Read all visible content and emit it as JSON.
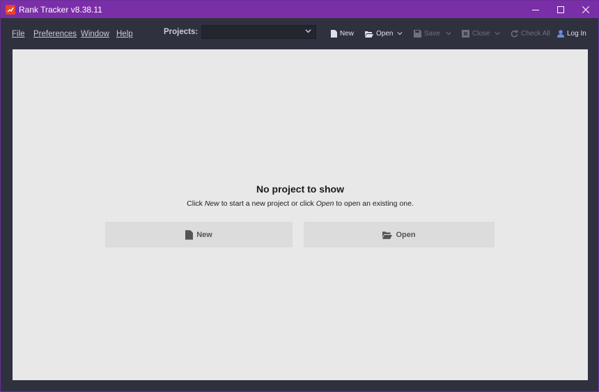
{
  "window": {
    "title": "Rank Tracker v8.38.11",
    "controls": [
      "minimize",
      "maximize",
      "close"
    ]
  },
  "menu": {
    "items": [
      {
        "label": "File"
      },
      {
        "label": "Preferences"
      },
      {
        "label": "Window"
      },
      {
        "label": "Help"
      }
    ]
  },
  "projects": {
    "label": "Projects:",
    "selected": ""
  },
  "toolbar": {
    "new_label": "New",
    "open_label": "Open",
    "save_label": "Save",
    "close_label": "Close",
    "check_all_label": "Check All",
    "login_label": "Log In"
  },
  "empty_state": {
    "title": "No project to show",
    "subtitle_1": "Click ",
    "subtitle_new": "New",
    "subtitle_2": " to start a new project or click ",
    "subtitle_open": "Open",
    "subtitle_3": " to open an existing one.",
    "new_button": "New",
    "open_button": "Open"
  },
  "colors": {
    "titlebar": "#7a2ea8",
    "toolbar_bg": "#2f323e",
    "content_bg": "#e8e8e8",
    "button_bg": "#dcdcdc",
    "accent_icon": "#e8442a"
  }
}
